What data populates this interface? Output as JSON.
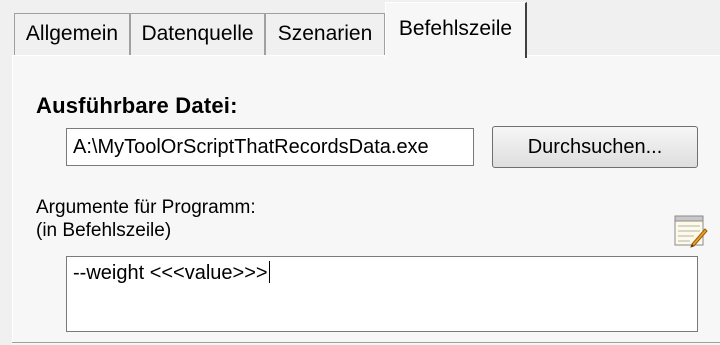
{
  "tabs": [
    {
      "label": "Allgemein",
      "active": false
    },
    {
      "label": "Datenquelle",
      "active": false
    },
    {
      "label": "Szenarien",
      "active": false
    },
    {
      "label": "Befehlszeile",
      "active": true
    }
  ],
  "executable": {
    "label": "Ausführbare Datei:",
    "value": "A:\\MyToolOrScriptThatRecordsData.exe",
    "browse_label": "Durchsuchen..."
  },
  "arguments": {
    "label_line1": "Argumente für Programm:",
    "label_line2": "(in Befehlszeile)",
    "value": "--weight <<<value>>>",
    "editor_icon": "notepad-edit-icon"
  }
}
